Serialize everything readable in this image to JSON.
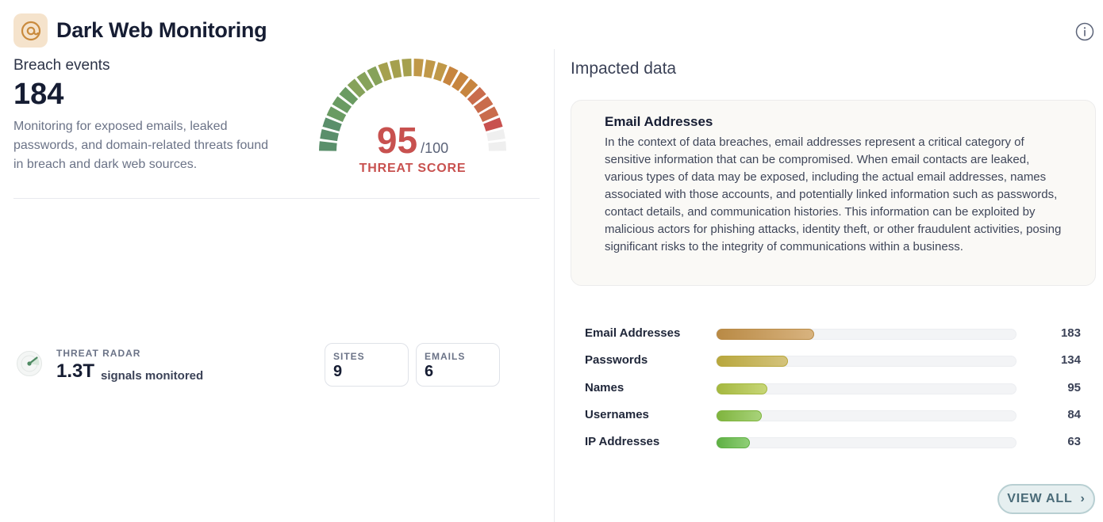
{
  "header": {
    "title": "Dark Web Monitoring",
    "logo_icon": "at-target-icon",
    "info_icon": "info-icon"
  },
  "breach": {
    "label": "Breach events",
    "count": "184",
    "description": "Monitoring for exposed emails, leaked passwords, and domain-related threats found in breach and dark web sources."
  },
  "threat_score": {
    "value": "95",
    "max": "/100",
    "label": "THREAT SCORE",
    "fraction": 0.95
  },
  "radar": {
    "label": "THREAT RADAR",
    "value": "1.3T",
    "sub": "signals monitored"
  },
  "stats": [
    {
      "label": "SITES",
      "value": "9"
    },
    {
      "label": "EMAILS",
      "value": "6"
    }
  ],
  "impacted": {
    "title": "Impacted data",
    "card_title": "Email Addresses",
    "card_body": "In the context of data breaches, email addresses represent a critical category of sensitive information that can be compromised. When email contacts are leaked, various types of data may be exposed, including the actual email addresses, names associated with those accounts, and potentially linked information such as passwords, contact details, and communication histories. This information can be exploited by malicious actors for phishing attacks, identity theft, or other fraudulent activities, posing significant risks to the integrity of communications within a business.",
    "items": [
      {
        "label": "Email Addresses",
        "value": "183",
        "count": 183,
        "from": "#b98a45",
        "to": "#d8b37f"
      },
      {
        "label": "Passwords",
        "value": "134",
        "count": 134,
        "from": "#b8a73d",
        "to": "#d4c37c"
      },
      {
        "label": "Names",
        "value": "95",
        "count": 95,
        "from": "#a5b840",
        "to": "#c7d677"
      },
      {
        "label": "Usernames",
        "value": "84",
        "count": 84,
        "from": "#7fb43e",
        "to": "#a8d37a"
      },
      {
        "label": "IP Addresses",
        "value": "63",
        "count": 63,
        "from": "#5fb044",
        "to": "#8fcf77"
      }
    ],
    "max_count": 560,
    "view_all": "VIEW ALL"
  },
  "colors": {
    "danger": "#c8514f",
    "accent": "#4a6b78"
  }
}
